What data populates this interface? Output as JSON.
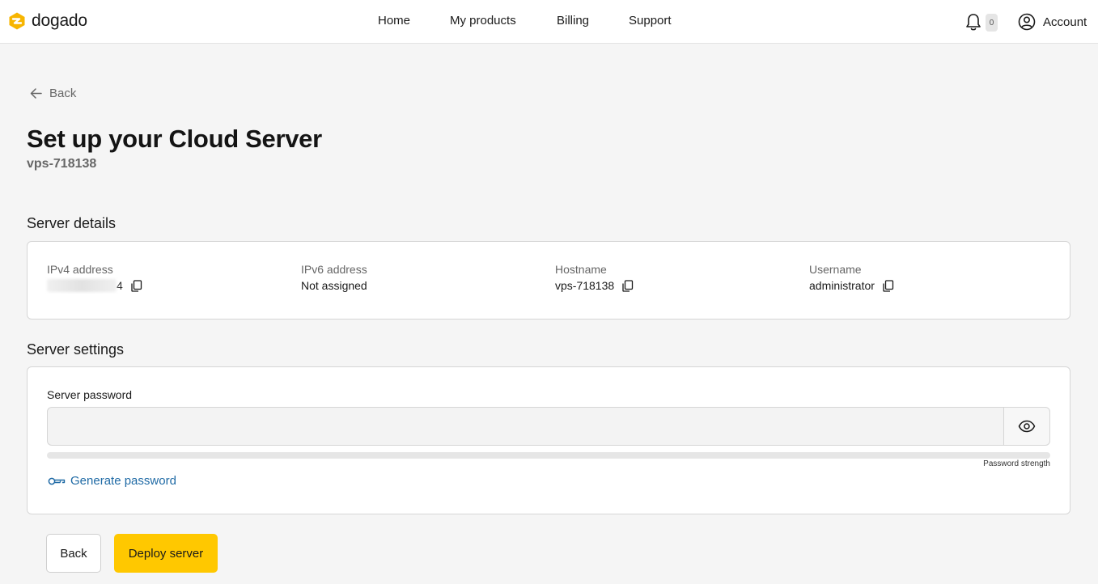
{
  "brand": {
    "name": "dogado",
    "accent": "#f7b500"
  },
  "nav": {
    "items": [
      {
        "label": "Home"
      },
      {
        "label": "My products"
      },
      {
        "label": "Billing"
      },
      {
        "label": "Support"
      }
    ]
  },
  "header": {
    "notification_count": "0",
    "account_label": "Account",
    "icons": {
      "notifications": "bell-icon",
      "account": "user-circle-icon"
    }
  },
  "page": {
    "back_label": "Back",
    "title": "Set up your Cloud Server",
    "subtitle": "vps-718138"
  },
  "server_details": {
    "section_title": "Server details",
    "fields": [
      {
        "label": "IPv4 address",
        "value_visible_tail": "4",
        "value_redacted": true,
        "copyable": true
      },
      {
        "label": "IPv6 address",
        "value": "Not assigned",
        "copyable": false
      },
      {
        "label": "Hostname",
        "value": "vps-718138",
        "copyable": true
      },
      {
        "label": "Username",
        "value": "administrator",
        "copyable": true
      }
    ]
  },
  "server_settings": {
    "section_title": "Server settings",
    "password_label": "Server password",
    "password_value": "",
    "password_strength": 0,
    "strength_label": "Password strength",
    "generate_label": "Generate password"
  },
  "actions": {
    "back_label": "Back",
    "deploy_label": "Deploy server",
    "deploy_color": "#ffc800"
  }
}
